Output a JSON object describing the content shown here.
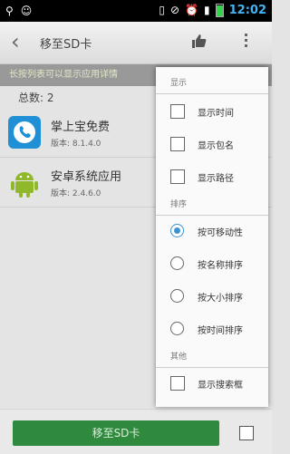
{
  "status_bar": {
    "time": "12:02",
    "battery_level": 0.85,
    "battery_color": "#34d34a",
    "icons": [
      "usb-icon",
      "android-debug-icon",
      "vibrate-icon",
      "sync-icon",
      "alarm-icon",
      "signal-icon"
    ]
  },
  "toolbar": {
    "title": "移至SD卡",
    "back_icon": "chevron-left-icon",
    "like_icon": "thumbs-up-icon",
    "overflow_icon": "overflow-menu-icon"
  },
  "hint": "长按列表可以显示应用详情",
  "count": "总数: 2",
  "apps": [
    {
      "name": "掌上宝免费",
      "version": "版本: 8.1.4.0",
      "icon": "phone-app-icon"
    },
    {
      "name": "安卓系统应用",
      "version": "版本: 2.4.6.0",
      "icon": "android-robot-icon"
    }
  ],
  "bottom": {
    "button_label": "移至SD卡",
    "button_color": "#2f8a3d",
    "select_all_checked": false
  },
  "menu": {
    "display": {
      "header": "显示",
      "options": [
        {
          "label": "显示时间",
          "checked": false
        },
        {
          "label": "显示包名",
          "checked": false
        },
        {
          "label": "显示路径",
          "checked": false
        }
      ]
    },
    "sort": {
      "header": "排序",
      "options": [
        {
          "label": "按可移动性",
          "selected": true
        },
        {
          "label": "按名称排序",
          "selected": false
        },
        {
          "label": "按大小排序",
          "selected": false
        },
        {
          "label": "按时间排序",
          "selected": false
        }
      ]
    },
    "other": {
      "header": "其他",
      "options": [
        {
          "label": "显示搜索框",
          "checked": false
        }
      ]
    },
    "accent_color": "#3e92cf"
  }
}
